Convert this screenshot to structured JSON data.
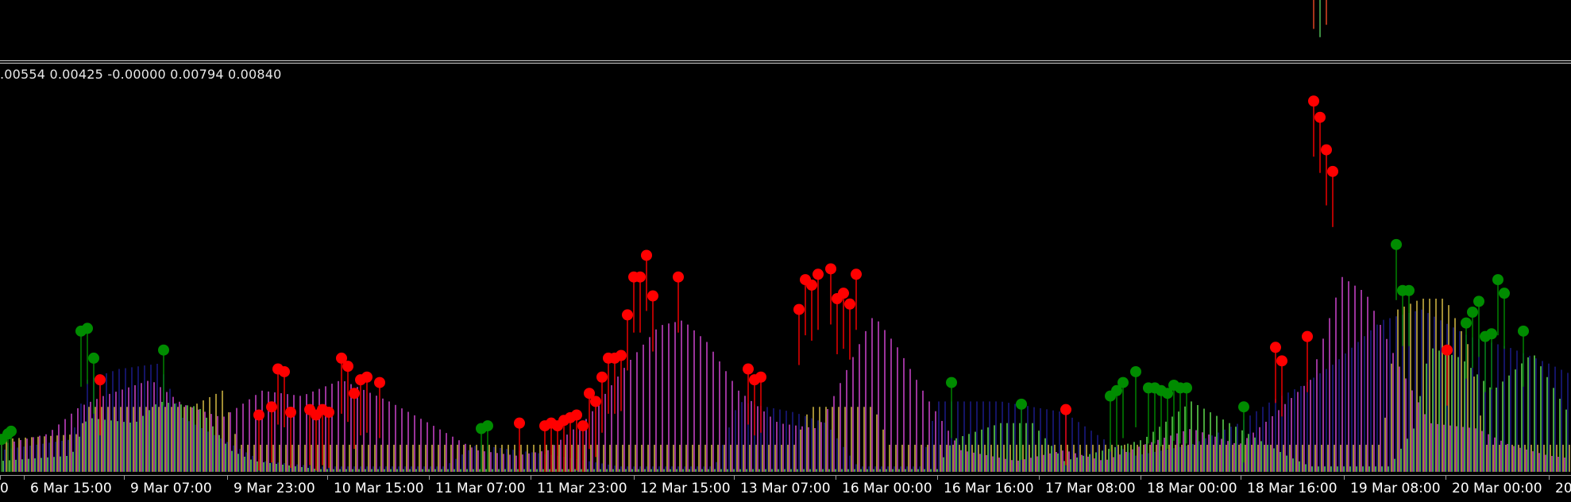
{
  "window": {
    "indicator_values_text": ".00554 0.00425 -0.00000 0.00794 0.00840"
  },
  "colors": {
    "background": "#000000",
    "separator": "#d8d8d8",
    "histogram_magenta": "#c040c0",
    "histogram_green": "#5bd04a",
    "histogram_navy": "#1a1a80",
    "histogram_gold": "#c8b040",
    "marker_red": "#ff0000",
    "marker_green": "#008c00",
    "axis_text": "#ffffff"
  },
  "time_axis": {
    "labels": [
      "0",
      "6 Mar 15:00",
      "9 Mar 07:00",
      "9 Mar 23:00",
      "10 Mar 15:00",
      "11 Mar 07:00",
      "11 Mar 23:00",
      "12 Mar 15:00",
      "13 Mar 07:00",
      "16 Mar 00:00",
      "16 Mar 16:00",
      "17 Mar 08:00",
      "18 Mar 00:00",
      "18 Mar 16:00",
      "19 Mar 08:00",
      "20 Mar 00:00",
      "20"
    ]
  },
  "chart_data": {
    "type": "bar",
    "categories": [
      "0",
      "6 Mar 15:00",
      "9 Mar 07:00",
      "9 Mar 23:00",
      "10 Mar 15:00",
      "11 Mar 07:00",
      "11 Mar 23:00",
      "12 Mar 15:00",
      "13 Mar 07:00",
      "16 Mar 00:00",
      "16 Mar 16:00",
      "17 Mar 08:00",
      "18 Mar 00:00",
      "18 Mar 16:00",
      "19 Mar 08:00",
      "20 Mar 00:00",
      "20"
    ],
    "series_anchors": {
      "main": [
        [
          0,
          0.001
        ],
        [
          60,
          0.0014
        ],
        [
          100,
          0.0024
        ],
        [
          130,
          0.0028
        ],
        [
          190,
          0.0034
        ],
        [
          230,
          0.0025
        ],
        [
          280,
          0.002
        ],
        [
          330,
          0.003
        ],
        [
          380,
          0.0028
        ],
        [
          430,
          0.0034
        ],
        [
          490,
          0.0026
        ],
        [
          540,
          0.0018
        ],
        [
          600,
          0.0008
        ],
        [
          650,
          0.0006
        ],
        [
          690,
          0.0008
        ],
        [
          740,
          0.002
        ],
        [
          790,
          0.004
        ],
        [
          830,
          0.0054
        ],
        [
          860,
          0.0056
        ],
        [
          890,
          0.0048
        ],
        [
          930,
          0.003
        ],
        [
          980,
          0.0018
        ],
        [
          1030,
          0.0016
        ],
        [
          1070,
          0.004
        ],
        [
          1100,
          0.0058
        ],
        [
          1130,
          0.0046
        ],
        [
          1170,
          0.0026
        ],
        [
          1210,
          0.0008
        ],
        [
          1280,
          0.0004
        ],
        [
          1340,
          0.0008
        ],
        [
          1390,
          0.0004
        ],
        [
          1440,
          0.001
        ],
        [
          1500,
          0.0016
        ],
        [
          1560,
          0.001
        ],
        [
          1600,
          0.002
        ],
        [
          1650,
          0.0034
        ],
        [
          1690,
          0.0072
        ],
        [
          1720,
          0.0066
        ],
        [
          1760,
          0.004
        ],
        [
          1800,
          0.0018
        ],
        [
          1860,
          0.0016
        ],
        [
          1900,
          0.001
        ],
        [
          1950,
          0.0006
        ],
        [
          1978,
          0.0005
        ]
      ],
      "green": [
        [
          0,
          0.0004
        ],
        [
          90,
          0.0006
        ],
        [
          110,
          0.002
        ],
        [
          170,
          0.0018
        ],
        [
          200,
          0.0026
        ],
        [
          250,
          0.0024
        ],
        [
          290,
          0.0008
        ],
        [
          320,
          0.0004
        ],
        [
          400,
          0.0001
        ],
        [
          600,
          0.0001
        ],
        [
          620,
          0.0001
        ],
        [
          1180,
          0.0001
        ],
        [
          1200,
          0.0012
        ],
        [
          1260,
          0.0018
        ],
        [
          1300,
          0.0018
        ],
        [
          1340,
          0.0004
        ],
        [
          1390,
          0.0008
        ],
        [
          1440,
          0.0012
        ],
        [
          1500,
          0.0026
        ],
        [
          1560,
          0.0016
        ],
        [
          1620,
          0.0006
        ],
        [
          1650,
          0.0002
        ],
        [
          1750,
          0.0002
        ],
        [
          1780,
          0.0016
        ],
        [
          1800,
          0.0046
        ],
        [
          1840,
          0.0042
        ],
        [
          1880,
          0.003
        ],
        [
          1930,
          0.0044
        ],
        [
          1978,
          0.002
        ]
      ],
      "navy": [
        [
          0,
          0.0008
        ],
        [
          90,
          0.0012
        ],
        [
          110,
          0.0034
        ],
        [
          150,
          0.0038
        ],
        [
          200,
          0.004
        ],
        [
          230,
          0.002
        ],
        [
          280,
          0.0012
        ],
        [
          330,
          0.0004
        ],
        [
          400,
          0.0002
        ],
        [
          560,
          0.0002
        ],
        [
          600,
          0.001
        ],
        [
          650,
          0.0008
        ],
        [
          700,
          0.0006
        ],
        [
          780,
          0.0002
        ],
        [
          900,
          0.0002
        ],
        [
          930,
          0.0026
        ],
        [
          1000,
          0.0022
        ],
        [
          1040,
          0.0018
        ],
        [
          1080,
          0.0002
        ],
        [
          1160,
          0.0002
        ],
        [
          1180,
          0.0026
        ],
        [
          1260,
          0.0026
        ],
        [
          1300,
          0.0024
        ],
        [
          1340,
          0.0022
        ],
        [
          1390,
          0.0012
        ],
        [
          1430,
          0.0006
        ],
        [
          1500,
          0.001
        ],
        [
          1560,
          0.0018
        ],
        [
          1600,
          0.0026
        ],
        [
          1640,
          0.0032
        ],
        [
          1680,
          0.004
        ],
        [
          1740,
          0.0056
        ],
        [
          1790,
          0.006
        ],
        [
          1850,
          0.005
        ],
        [
          1900,
          0.0046
        ],
        [
          1950,
          0.004
        ],
        [
          1978,
          0.0036
        ]
      ],
      "gold": [
        [
          0,
          0.0012
        ],
        [
          100,
          0.0014
        ],
        [
          110,
          0.0024
        ],
        [
          240,
          0.0024
        ],
        [
          280,
          0.003
        ],
        [
          300,
          0.001
        ],
        [
          1000,
          0.001
        ],
        [
          1020,
          0.0024
        ],
        [
          1100,
          0.0024
        ],
        [
          1120,
          0.001
        ],
        [
          1740,
          0.001
        ],
        [
          1760,
          0.006
        ],
        [
          1790,
          0.0064
        ],
        [
          1820,
          0.0064
        ],
        [
          1850,
          0.0046
        ],
        [
          1870,
          0.001
        ],
        [
          1978,
          0.001
        ]
      ]
    },
    "red_markers": [
      [
        126,
        0.0034
      ],
      [
        326,
        0.0021
      ],
      [
        342,
        0.0024
      ],
      [
        350,
        0.0038
      ],
      [
        358,
        0.0037
      ],
      [
        366,
        0.0022
      ],
      [
        390,
        0.0023
      ],
      [
        398,
        0.0021
      ],
      [
        406,
        0.0023
      ],
      [
        414,
        0.0022
      ],
      [
        430,
        0.0042
      ],
      [
        438,
        0.0039
      ],
      [
        446,
        0.0029
      ],
      [
        454,
        0.0034
      ],
      [
        462,
        0.0035
      ],
      [
        478,
        0.0033
      ],
      [
        654,
        0.0018
      ],
      [
        686,
        0.0017
      ],
      [
        694,
        0.0018
      ],
      [
        702,
        0.0017
      ],
      [
        710,
        0.0019
      ],
      [
        718,
        0.002
      ],
      [
        726,
        0.0021
      ],
      [
        734,
        0.0017
      ],
      [
        742,
        0.0029
      ],
      [
        750,
        0.0026
      ],
      [
        758,
        0.0035
      ],
      [
        766,
        0.0042
      ],
      [
        774,
        0.0042
      ],
      [
        782,
        0.0043
      ],
      [
        790,
        0.0058
      ],
      [
        798,
        0.0072
      ],
      [
        806,
        0.0072
      ],
      [
        814,
        0.008
      ],
      [
        822,
        0.0065
      ],
      [
        854,
        0.0072
      ],
      [
        942,
        0.0038
      ],
      [
        950,
        0.0034
      ],
      [
        958,
        0.0035
      ],
      [
        1006,
        0.006
      ],
      [
        1014,
        0.0071
      ],
      [
        1022,
        0.0069
      ],
      [
        1030,
        0.0073
      ],
      [
        1046,
        0.0075
      ],
      [
        1054,
        0.0064
      ],
      [
        1062,
        0.0066
      ],
      [
        1070,
        0.0062
      ],
      [
        1078,
        0.0073
      ],
      [
        1342,
        0.0023
      ],
      [
        1606,
        0.0046
      ],
      [
        1614,
        0.0041
      ],
      [
        1646,
        0.005
      ],
      [
        1654,
        0.0137
      ],
      [
        1662,
        0.0131
      ],
      [
        1670,
        0.0119
      ],
      [
        1678,
        0.0111
      ],
      [
        1822,
        0.0045
      ]
    ],
    "green_markers": [
      [
        2,
        0.0012
      ],
      [
        10,
        0.0014
      ],
      [
        14,
        0.0015
      ],
      [
        102,
        0.0052
      ],
      [
        110,
        0.0053
      ],
      [
        118,
        0.0042
      ],
      [
        206,
        0.0045
      ],
      [
        606,
        0.0016
      ],
      [
        614,
        0.0017
      ],
      [
        1198,
        0.0033
      ],
      [
        1286,
        0.0025
      ],
      [
        1398,
        0.0028
      ],
      [
        1406,
        0.003
      ],
      [
        1414,
        0.0033
      ],
      [
        1430,
        0.0037
      ],
      [
        1446,
        0.0031
      ],
      [
        1454,
        0.0031
      ],
      [
        1462,
        0.003
      ],
      [
        1470,
        0.0029
      ],
      [
        1478,
        0.0032
      ],
      [
        1486,
        0.0031
      ],
      [
        1494,
        0.0031
      ],
      [
        1566,
        0.0024
      ],
      [
        1758,
        0.0084
      ],
      [
        1766,
        0.0067
      ],
      [
        1774,
        0.0067
      ],
      [
        1846,
        0.0055
      ],
      [
        1854,
        0.0059
      ],
      [
        1862,
        0.0063
      ],
      [
        1870,
        0.005
      ],
      [
        1878,
        0.0051
      ],
      [
        1886,
        0.0071
      ],
      [
        1894,
        0.0066
      ],
      [
        1918,
        0.0052
      ]
    ],
    "upper_pane_bars": [
      [
        1654,
        0.7
      ],
      [
        1662,
        0.9
      ],
      [
        1670,
        0.6
      ]
    ],
    "ylim": [
      0,
      0.0145
    ]
  }
}
